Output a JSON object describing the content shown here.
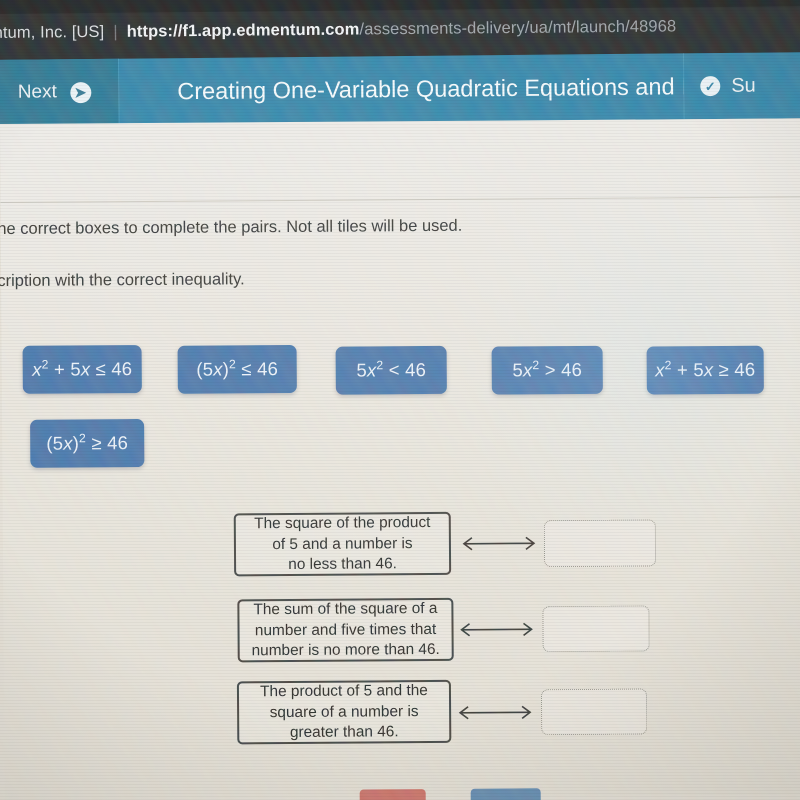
{
  "browser": {
    "site_identity": "entum, Inc. [US]",
    "url_scheme": "https://",
    "url_host": "f1.app.edmentum.com",
    "url_path": "/assessments-delivery/ua/mt/launch/48968"
  },
  "toolbar": {
    "next_label": "Next",
    "next_icon": "arrow-right-circle-icon",
    "assessment_title": "Creating One-Variable Quadratic Equations and Inequal",
    "submit_label": "Su",
    "submit_icon": "check-circle-icon"
  },
  "instructions": {
    "line1": "the correct boxes to complete the pairs. Not all tiles will be used.",
    "line2": "scription with the correct inequality."
  },
  "tiles": [
    {
      "id": "tile-1",
      "text": "x2 + 5x ≤ 46",
      "html": "<i>x</i><sup>2</sup> + 5<i>x</i> ≤ 46"
    },
    {
      "id": "tile-2",
      "text": "(5x)2 ≤ 46",
      "html": "(5<i>x</i>)<sup>2</sup> ≤ 46"
    },
    {
      "id": "tile-3",
      "text": "5x2 < 46",
      "html": "5<i>x</i><sup>2</sup> &lt; 46"
    },
    {
      "id": "tile-4",
      "text": "5x2 > 46",
      "html": "5<i>x</i><sup>2</sup> &gt; 46"
    },
    {
      "id": "tile-5",
      "text": "x2 + 5x ≥ 46",
      "html": "<i>x</i><sup>2</sup> + 5<i>x</i> ≥ 46"
    },
    {
      "id": "tile-6",
      "text": "(5x)2 ≥ 46",
      "html": "(5<i>x</i>)<sup>2</sup> ≥ 46"
    }
  ],
  "pairs": [
    {
      "id": "pair-1",
      "description": "The square of the product of 5 and a number is no less than 46.",
      "lines": [
        "The square of the product",
        "of 5 and a number is",
        "no less than 46."
      ],
      "answer": ""
    },
    {
      "id": "pair-2",
      "description": "The sum of the square of a number and five times that number is no more than 46.",
      "lines": [
        "The sum of the square of a",
        "number and five times that",
        "number is no more than 46."
      ],
      "answer": ""
    },
    {
      "id": "pair-3",
      "description": "The product of 5 and the square of a number is greater than 46.",
      "lines": [
        "The product of 5 and the",
        "square of a number is",
        "greater than 46."
      ],
      "answer": ""
    }
  ],
  "colors": {
    "toolbar_blue": "#2b7ea4",
    "next_blue": "#24718f",
    "tile_blue": "#3f6da4",
    "page_bg": "#e7e3da",
    "reset_button": "#c96a62",
    "next_button": "#5b84ab"
  }
}
